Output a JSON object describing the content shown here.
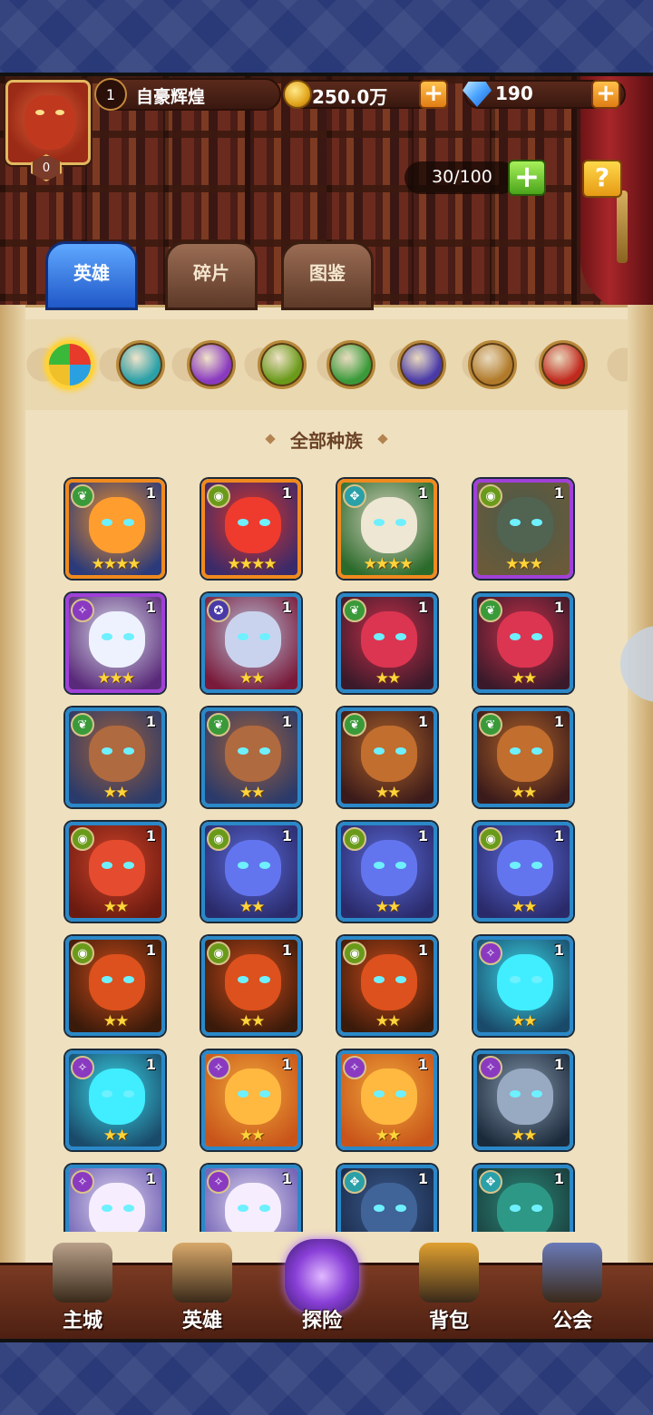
{
  "player": {
    "level": "1",
    "name": "自豪辉煌",
    "vip": "0"
  },
  "currency": {
    "gold": "250.0万",
    "gems": "190",
    "plus": "+"
  },
  "roster": {
    "capacity": "30/100",
    "add": "+",
    "help": "?"
  },
  "tabs": [
    {
      "label": "英雄"
    },
    {
      "label": "碎片"
    },
    {
      "label": "图鉴"
    }
  ],
  "races": [
    {
      "icon": "all-races-icon",
      "color": "#e65a2a"
    },
    {
      "icon": "water-race-icon",
      "color": "#2aa0a8"
    },
    {
      "icon": "arcane-race-icon",
      "color": "#8a3ac0"
    },
    {
      "icon": "eye-race-icon",
      "color": "#6a9a1a"
    },
    {
      "icon": "nature-race-icon",
      "color": "#3a9a3a"
    },
    {
      "icon": "demon-race-icon",
      "color": "#4a3aa8"
    },
    {
      "icon": "wheel-race-icon",
      "color": "#b07a2a"
    },
    {
      "icon": "flame-race-icon",
      "color": "#c02a1e"
    }
  ],
  "section_title": "全部种族",
  "heroes": [
    {
      "level": "1",
      "stars": "★★★★",
      "rarity": "orange",
      "race": "nature",
      "palette": [
        "#f0902a",
        "#2a3a7a"
      ]
    },
    {
      "level": "1",
      "stars": "★★★★",
      "rarity": "orange",
      "race": "eye",
      "palette": [
        "#d8362a",
        "#3a2a6a"
      ]
    },
    {
      "level": "1",
      "stars": "★★★★",
      "rarity": "orange",
      "race": "water",
      "palette": [
        "#d8d2c0",
        "#2a6a2a"
      ]
    },
    {
      "level": "1",
      "stars": "★★★",
      "rarity": "purple",
      "race": "eye",
      "palette": [
        "#4a5a4a",
        "#6a5a3a"
      ]
    },
    {
      "level": "1",
      "stars": "★★★",
      "rarity": "purple",
      "race": "arcane",
      "palette": [
        "#d8dce8",
        "#5a2a7a"
      ]
    },
    {
      "level": "1",
      "stars": "★★",
      "rarity": "blue",
      "race": "demon",
      "palette": [
        "#b8c0d8",
        "#7a1a3a"
      ]
    },
    {
      "level": "1",
      "stars": "★★",
      "rarity": "blue",
      "race": "nature",
      "palette": [
        "#c8304a",
        "#3a1a2a"
      ]
    },
    {
      "level": "1",
      "stars": "★★",
      "rarity": "blue",
      "race": "nature",
      "palette": [
        "#c8304a",
        "#3a1a2a"
      ]
    },
    {
      "level": "1",
      "stars": "★★",
      "rarity": "blue",
      "race": "nature",
      "palette": [
        "#a0603a",
        "#2a3a6a"
      ]
    },
    {
      "level": "1",
      "stars": "★★",
      "rarity": "blue",
      "race": "nature",
      "palette": [
        "#a0603a",
        "#2a3a6a"
      ]
    },
    {
      "level": "1",
      "stars": "★★",
      "rarity": "blue",
      "race": "nature",
      "palette": [
        "#b0642a",
        "#3a1a1a"
      ]
    },
    {
      "level": "1",
      "stars": "★★",
      "rarity": "blue",
      "race": "nature",
      "palette": [
        "#b0642a",
        "#3a1a1a"
      ]
    },
    {
      "level": "1",
      "stars": "★★",
      "rarity": "blue",
      "race": "eye",
      "palette": [
        "#d0442a",
        "#6a1a10"
      ]
    },
    {
      "level": "1",
      "stars": "★★",
      "rarity": "blue",
      "race": "eye",
      "palette": [
        "#5a6ad8",
        "#2a2a6a"
      ]
    },
    {
      "level": "1",
      "stars": "★★",
      "rarity": "blue",
      "race": "eye",
      "palette": [
        "#5a6ad8",
        "#2a2a6a"
      ]
    },
    {
      "level": "1",
      "stars": "★★",
      "rarity": "blue",
      "race": "eye",
      "palette": [
        "#5a6ad8",
        "#2a2a6a"
      ]
    },
    {
      "level": "1",
      "stars": "★★",
      "rarity": "blue",
      "race": "eye",
      "palette": [
        "#c84a1a",
        "#3a1a0a"
      ]
    },
    {
      "level": "1",
      "stars": "★★",
      "rarity": "blue",
      "race": "eye",
      "palette": [
        "#c84a1a",
        "#3a1a0a"
      ]
    },
    {
      "level": "1",
      "stars": "★★",
      "rarity": "blue",
      "race": "eye",
      "palette": [
        "#c84a1a",
        "#3a1a0a"
      ]
    },
    {
      "level": "1",
      "stars": "★★",
      "rarity": "blue",
      "race": "arcane",
      "palette": [
        "#3ad8e8",
        "#1a4a6a"
      ]
    },
    {
      "level": "1",
      "stars": "★★",
      "rarity": "blue",
      "race": "arcane",
      "palette": [
        "#3ad8e8",
        "#1a4a6a"
      ]
    },
    {
      "level": "1",
      "stars": "★★",
      "rarity": "blue",
      "race": "arcane",
      "palette": [
        "#f0a83a",
        "#c8541a"
      ]
    },
    {
      "level": "1",
      "stars": "★★",
      "rarity": "blue",
      "race": "arcane",
      "palette": [
        "#f0a83a",
        "#c8541a"
      ]
    },
    {
      "level": "1",
      "stars": "★★",
      "rarity": "blue",
      "race": "arcane",
      "palette": [
        "#8a9ab0",
        "#1a2a3a"
      ]
    },
    {
      "level": "1",
      "stars": "★★",
      "rarity": "blue",
      "race": "arcane",
      "palette": [
        "#e0d8f0",
        "#6a5ab0"
      ]
    },
    {
      "level": "1",
      "stars": "★★",
      "rarity": "blue",
      "race": "arcane",
      "palette": [
        "#e0d8f0",
        "#6a5ab0"
      ]
    },
    {
      "level": "1",
      "stars": "★★",
      "rarity": "blue",
      "race": "water",
      "palette": [
        "#3a5a8a",
        "#1a2a4a"
      ]
    },
    {
      "level": "1",
      "stars": "★★",
      "rarity": "blue",
      "race": "water",
      "palette": [
        "#2a8a7a",
        "#1a3a3a"
      ]
    }
  ],
  "nav": [
    {
      "label": "主城",
      "icon": "castle-icon",
      "color": "#b8a08a"
    },
    {
      "label": "英雄",
      "icon": "hero-portrait-icon",
      "color": "#d8a86a"
    },
    {
      "label": "探险",
      "icon": "portal-icon",
      "color": "#8a40d8"
    },
    {
      "label": "背包",
      "icon": "backpack-icon",
      "color": "#e0a030"
    },
    {
      "label": "公会",
      "icon": "guild-tower-icon",
      "color": "#6a7ab8"
    }
  ]
}
